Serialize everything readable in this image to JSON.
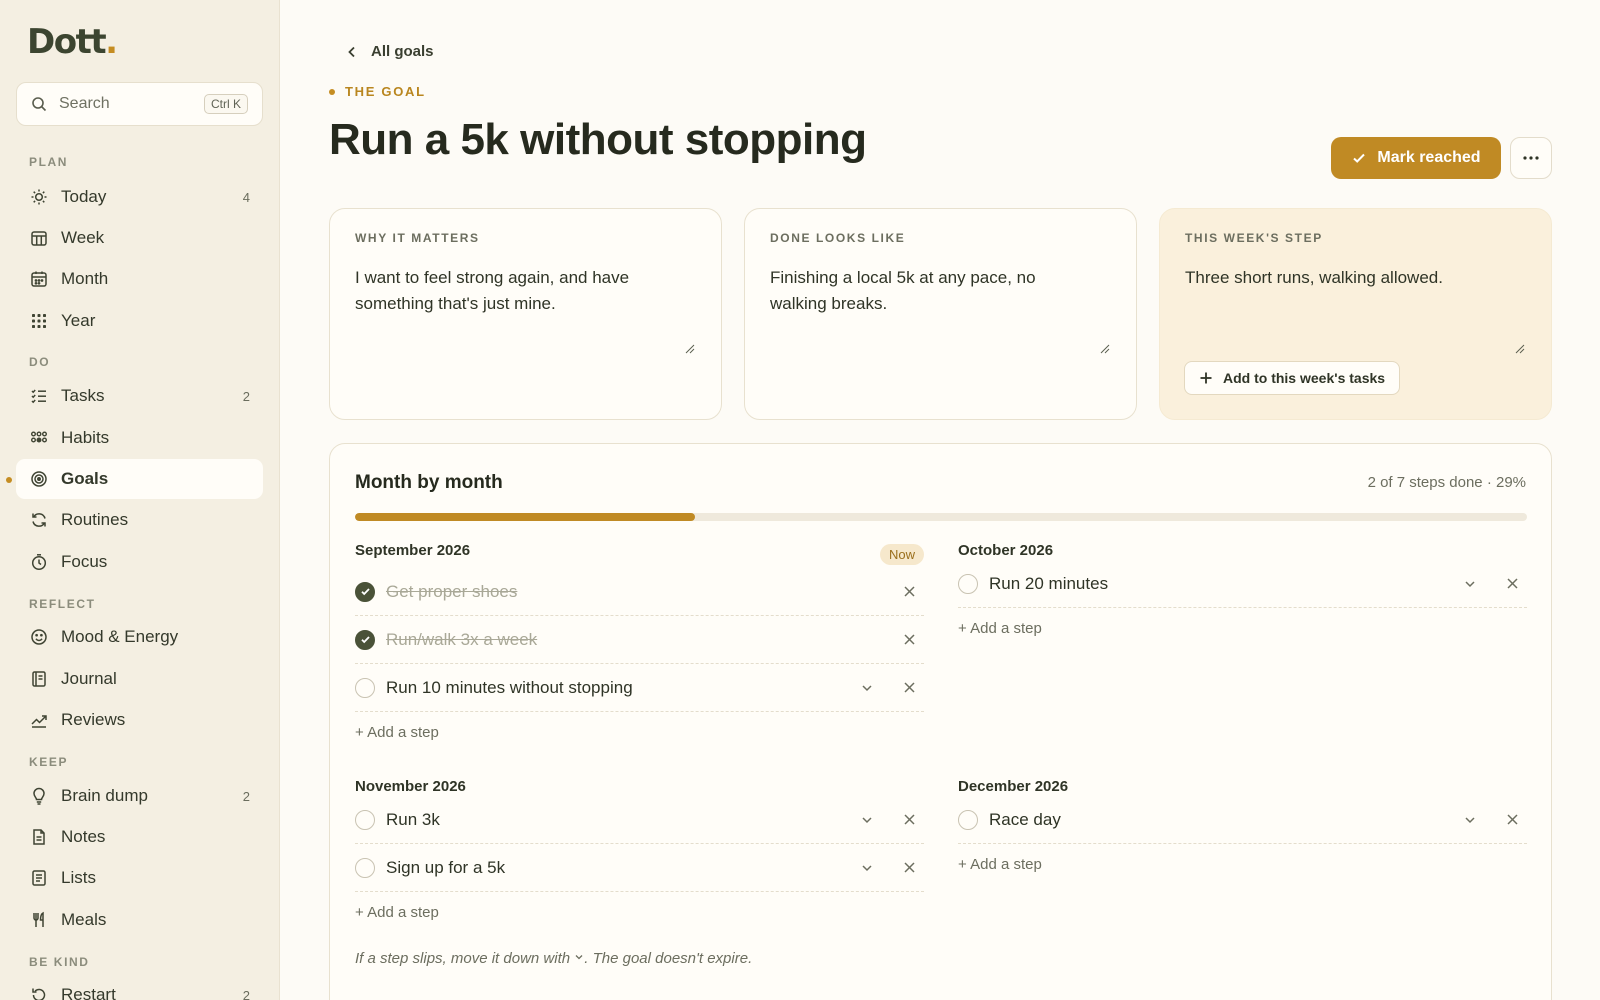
{
  "app": {
    "logo_text": "Dott",
    "logo_dot": ".",
    "accent": "#c08a24"
  },
  "search": {
    "placeholder": "Search",
    "shortcut": "Ctrl K"
  },
  "sidebar": {
    "sections": [
      {
        "label": "PLAN"
      },
      {
        "label": "DO"
      },
      {
        "label": "REFLECT"
      },
      {
        "label": "KEEP"
      },
      {
        "label": "BE KIND"
      }
    ],
    "items": [
      {
        "label": "Today",
        "count": "4",
        "icon": "sun-icon"
      },
      {
        "label": "Week",
        "count": "",
        "icon": "week-calendar-icon"
      },
      {
        "label": "Month",
        "count": "",
        "icon": "month-calendar-icon"
      },
      {
        "label": "Year",
        "count": "",
        "icon": "year-grid-icon"
      },
      {
        "label": "Tasks",
        "count": "2",
        "icon": "task-list-icon"
      },
      {
        "label": "Habits",
        "count": "",
        "icon": "habits-dots-icon"
      },
      {
        "label": "Goals",
        "count": "",
        "icon": "target-icon",
        "active": true
      },
      {
        "label": "Routines",
        "count": "",
        "icon": "refresh-icon"
      },
      {
        "label": "Focus",
        "count": "",
        "icon": "timer-icon"
      },
      {
        "label": "Mood & Energy",
        "count": "",
        "icon": "smiley-icon"
      },
      {
        "label": "Journal",
        "count": "",
        "icon": "journal-icon"
      },
      {
        "label": "Reviews",
        "count": "",
        "icon": "trend-icon"
      },
      {
        "label": "Brain dump",
        "count": "2",
        "icon": "lightbulb-icon"
      },
      {
        "label": "Notes",
        "count": "",
        "icon": "note-icon"
      },
      {
        "label": "Lists",
        "count": "",
        "icon": "list-icon"
      },
      {
        "label": "Meals",
        "count": "",
        "icon": "fork-knife-icon"
      },
      {
        "label": "Restart",
        "count": "2",
        "icon": "restart-icon"
      }
    ]
  },
  "header": {
    "back_label": "All goals",
    "eyebrow": "THE GOAL",
    "title": "Run a 5k without stopping",
    "mark_label": "Mark reached"
  },
  "cards": [
    {
      "label": "WHY IT MATTERS",
      "text": "I want to feel strong again, and have something that's just mine."
    },
    {
      "label": "DONE LOOKS LIKE",
      "text": "Finishing a local 5k at any pace, no walking breaks."
    },
    {
      "label": "THIS WEEK'S STEP",
      "text": "Three short runs, walking allowed.",
      "button": "Add to this week's tasks"
    }
  ],
  "plan": {
    "title": "Month by month",
    "meta": "2 of 7 steps done · 29%",
    "progress": 0.29,
    "add_step_label": "+ Add a step",
    "now_badge": "Now",
    "months": [
      {
        "name": "September 2026",
        "now": true,
        "steps": [
          {
            "text": "Get proper shoes",
            "done": true
          },
          {
            "text": "Run/walk 3x a week",
            "done": true
          },
          {
            "text": "Run 10 minutes without stopping",
            "done": false
          }
        ]
      },
      {
        "name": "October 2026",
        "now": false,
        "steps": [
          {
            "text": "Run 20 minutes",
            "done": false
          }
        ]
      },
      {
        "name": "November 2026",
        "now": false,
        "steps": [
          {
            "text": "Run 3k",
            "done": false
          },
          {
            "text": "Sign up for a 5k",
            "done": false
          }
        ]
      },
      {
        "name": "December 2026",
        "now": false,
        "steps": [
          {
            "text": "Race day",
            "done": false
          }
        ]
      }
    ],
    "footnote_before": "If a step slips, move it down with",
    "footnote_after": ". The goal doesn't expire."
  }
}
